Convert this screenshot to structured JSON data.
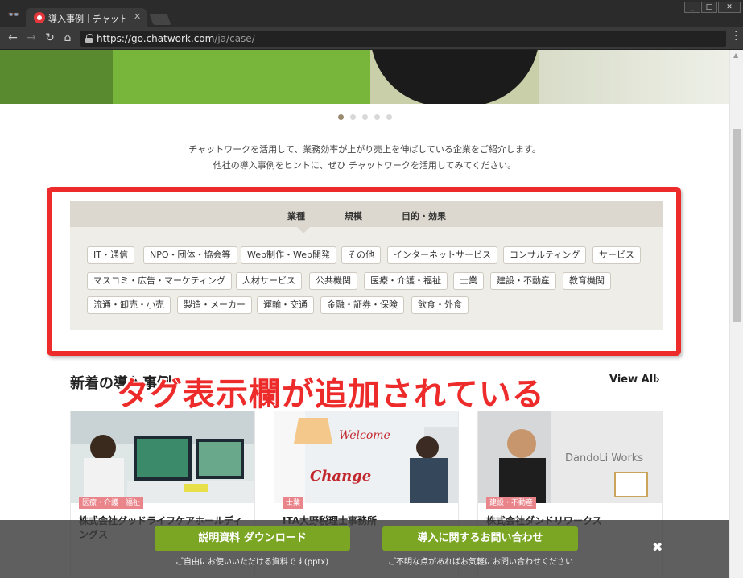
{
  "browser": {
    "tab_title": "導入事例｜チャットワーク",
    "url_base": "https://go.chatwork.com",
    "url_path": "/ja/case/"
  },
  "carousel": {
    "dot_count": 5,
    "active_index": 0
  },
  "intro": {
    "line1": "チャットワークを活用して、業務効率が上がり売上を伸ばしている企業をご紹介します。",
    "line2": "他社の導入事例をヒントに、ぜひ チャットワークを活用してみてください。"
  },
  "tag_tabs": [
    "業種",
    "規模",
    "目的・効果"
  ],
  "tags": [
    "IT・通信",
    "NPO・団体・協会等",
    "Web制作・Web開発",
    "その他",
    "インターネットサービス",
    "コンサルティング",
    "サービス",
    "マスコミ・広告・マーケティング",
    "人材サービス",
    "公共機関",
    "医療・介護・福祉",
    "士業",
    "建設・不動産",
    "教育機関",
    "流通・卸売・小売",
    "製造・メーカー",
    "運輸・交通",
    "金融・証券・保険",
    "飲食・外食"
  ],
  "new_section": {
    "title": "新着の導入事例",
    "view_all": "View All"
  },
  "annotation": "タグ表示欄が追加されている",
  "cards": [
    {
      "category": "医療・介護・福祉",
      "title": "株式会社グッドライフケアホールディングス"
    },
    {
      "category": "士業",
      "title": "ITA大野税理士事務所",
      "img_text1": "Welcome",
      "img_text2": "Change"
    },
    {
      "category": "建設・不動産",
      "title": "株式会社ダンドリワークス",
      "img_text1": "DandoLi Works"
    }
  ],
  "cta": {
    "btn1": "説明資料 ダウンロード",
    "sub1": "ご自由にお使いいただける資料です(pptx)",
    "btn2": "導入に関するお問い合わせ",
    "sub2": "ご不明な点があればお気軽にお問い合わせください",
    "close": "✖"
  },
  "colors": {
    "accent_red": "#ee2b2b",
    "cta_green": "#7ba623",
    "tag_bg": "#efede7"
  }
}
